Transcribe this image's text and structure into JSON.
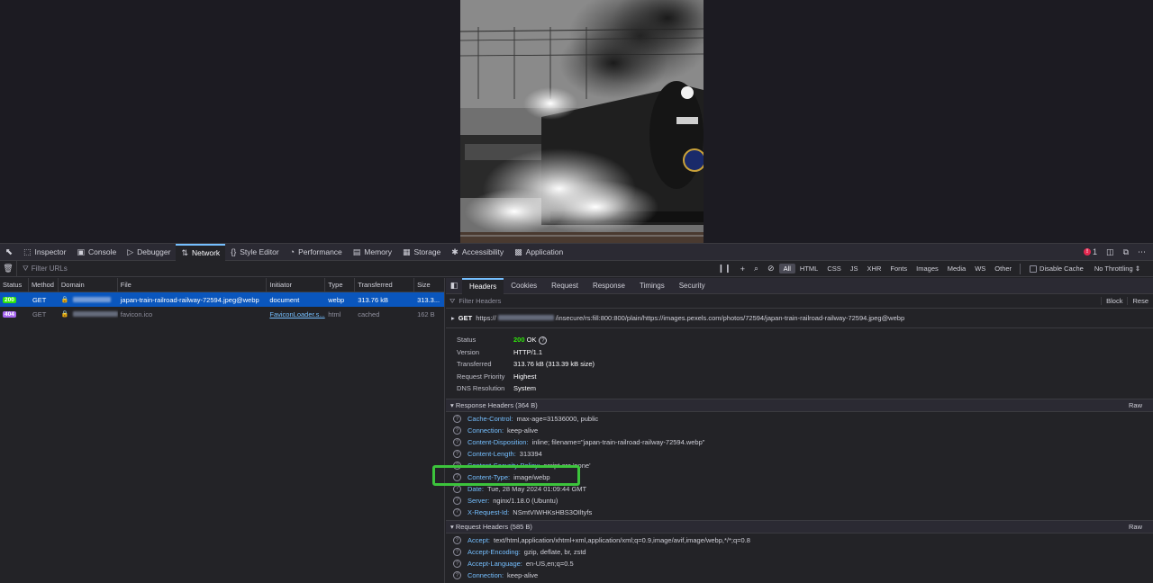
{
  "toolbox": {
    "tabs": [
      {
        "label": "Inspector",
        "icon": "inspector-icon",
        "glyph": "⬚"
      },
      {
        "label": "Console",
        "icon": "console-icon",
        "glyph": "▣"
      },
      {
        "label": "Debugger",
        "icon": "debugger-icon",
        "glyph": "▷"
      },
      {
        "label": "Network",
        "icon": "network-icon",
        "glyph": "⇅"
      },
      {
        "label": "Style Editor",
        "icon": "style-editor-icon",
        "glyph": "{}"
      },
      {
        "label": "Performance",
        "icon": "performance-icon",
        "glyph": "◔"
      },
      {
        "label": "Memory",
        "icon": "memory-icon",
        "glyph": "▤"
      },
      {
        "label": "Storage",
        "icon": "storage-icon",
        "glyph": "▦"
      },
      {
        "label": "Accessibility",
        "icon": "accessibility-icon",
        "glyph": "✱"
      },
      {
        "label": "Application",
        "icon": "application-icon",
        "glyph": "▩"
      }
    ],
    "active_tab": "Network",
    "error_count": "1"
  },
  "filterbar": {
    "placeholder": "Filter URLs",
    "types": [
      "All",
      "HTML",
      "CSS",
      "JS",
      "XHR",
      "Fonts",
      "Images",
      "Media",
      "WS",
      "Other"
    ],
    "active_type": "All",
    "disable_cache_label": "Disable Cache",
    "throttling": "No Throttling ⇕"
  },
  "request_list": {
    "columns": [
      "Status",
      "Method",
      "Domain",
      "File",
      "Initiator",
      "Type",
      "Transferred",
      "Size"
    ],
    "rows": [
      {
        "status": "200",
        "method": "GET",
        "file": "japan-train-railroad-railway-72594.jpeg@webp",
        "initiator": "document",
        "type": "webp",
        "transferred": "313.76 kB",
        "size": "313.3..."
      },
      {
        "status": "404",
        "method": "GET",
        "file": "favicon.ico",
        "initiator": "FaviconLoader.s...",
        "type": "html",
        "transferred": "cached",
        "size": "162 B"
      }
    ]
  },
  "details": {
    "tabs": [
      "Headers",
      "Cookies",
      "Request",
      "Response",
      "Timings",
      "Security"
    ],
    "active_tab": "Headers",
    "filter_placeholder": "Filter Headers",
    "block_label": "Block",
    "resend_label": "Rese",
    "request_method": "GET",
    "request_url_prefix": "https://",
    "request_url_rest": "/insecure/rs:fill:800:800/plain/https://images.pexels.com/photos/72594/japan-train-railroad-railway-72594.jpeg@webp",
    "summary": {
      "status_label": "Status",
      "status_code": "200",
      "status_text": "OK",
      "version_label": "Version",
      "version": "HTTP/1.1",
      "transferred_label": "Transferred",
      "transferred": "313.76 kB (313.39 kB size)",
      "priority_label": "Request Priority",
      "priority": "Highest",
      "dns_label": "DNS Resolution",
      "dns": "System"
    },
    "response_headers_title": "Response Headers (364 B)",
    "request_headers_title": "Request Headers (585 B)",
    "raw_label": "Raw",
    "response_headers": [
      {
        "name": "Cache-Control:",
        "value": "max-age=31536000, public"
      },
      {
        "name": "Connection:",
        "value": "keep-alive"
      },
      {
        "name": "Content-Disposition:",
        "value": "inline; filename=\"japan-train-railroad-railway-72594.webp\""
      },
      {
        "name": "Content-Length:",
        "value": "313394"
      },
      {
        "name": "Content-Security-Policy:",
        "value": "script-src 'none'"
      },
      {
        "name": "Content-Type:",
        "value": "image/webp"
      },
      {
        "name": "Date:",
        "value": "Tue, 28 May 2024 01:09:44 GMT"
      },
      {
        "name": "Server:",
        "value": "nginx/1.18.0 (Ubuntu)"
      },
      {
        "name": "X-Request-Id:",
        "value": "NSmtVIWHKsHBS3OIltyfs"
      }
    ],
    "request_headers": [
      {
        "name": "Accept:",
        "value": "text/html,application/xhtml+xml,application/xml;q=0.9,image/avif,image/webp,*/*;q=0.8"
      },
      {
        "name": "Accept-Encoding:",
        "value": "gzip, deflate, br, zstd"
      },
      {
        "name": "Accept-Language:",
        "value": "en-US,en;q=0.5"
      },
      {
        "name": "Connection:",
        "value": "keep-alive"
      }
    ]
  },
  "highlight_color": "#3cc43c"
}
